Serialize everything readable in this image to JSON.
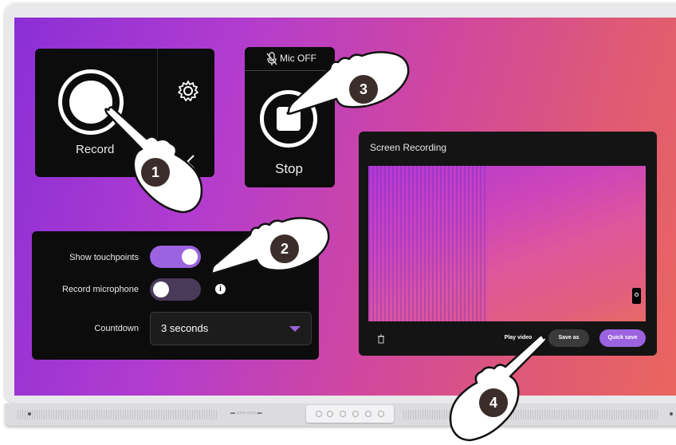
{
  "record_panel": {
    "label": "Record",
    "icons": [
      "record-icon",
      "gear-icon",
      "chevron-left-icon"
    ]
  },
  "stop_panel": {
    "mic_status": "Mic OFF",
    "label": "Stop",
    "icons": [
      "mic-off-icon",
      "stop-icon"
    ]
  },
  "settings_panel": {
    "show_touchpoints": {
      "label": "Show touchpoints",
      "state": "on"
    },
    "record_microphone": {
      "label": "Record microphone",
      "state": "off"
    },
    "countdown": {
      "label": "Countdown",
      "value": "3 seconds"
    }
  },
  "screen_recording": {
    "title": "Screen Recording",
    "buttons": {
      "play": "Play video",
      "save_as": "Save as",
      "quick_save": "Quick save"
    },
    "icons": [
      "trash-icon",
      "camera-icon"
    ]
  },
  "steps": [
    "1",
    "2",
    "3",
    "4"
  ],
  "colors": {
    "accent": "#9b63e0",
    "panel": "#0c0c0c",
    "badge": "#3b2d2a"
  }
}
